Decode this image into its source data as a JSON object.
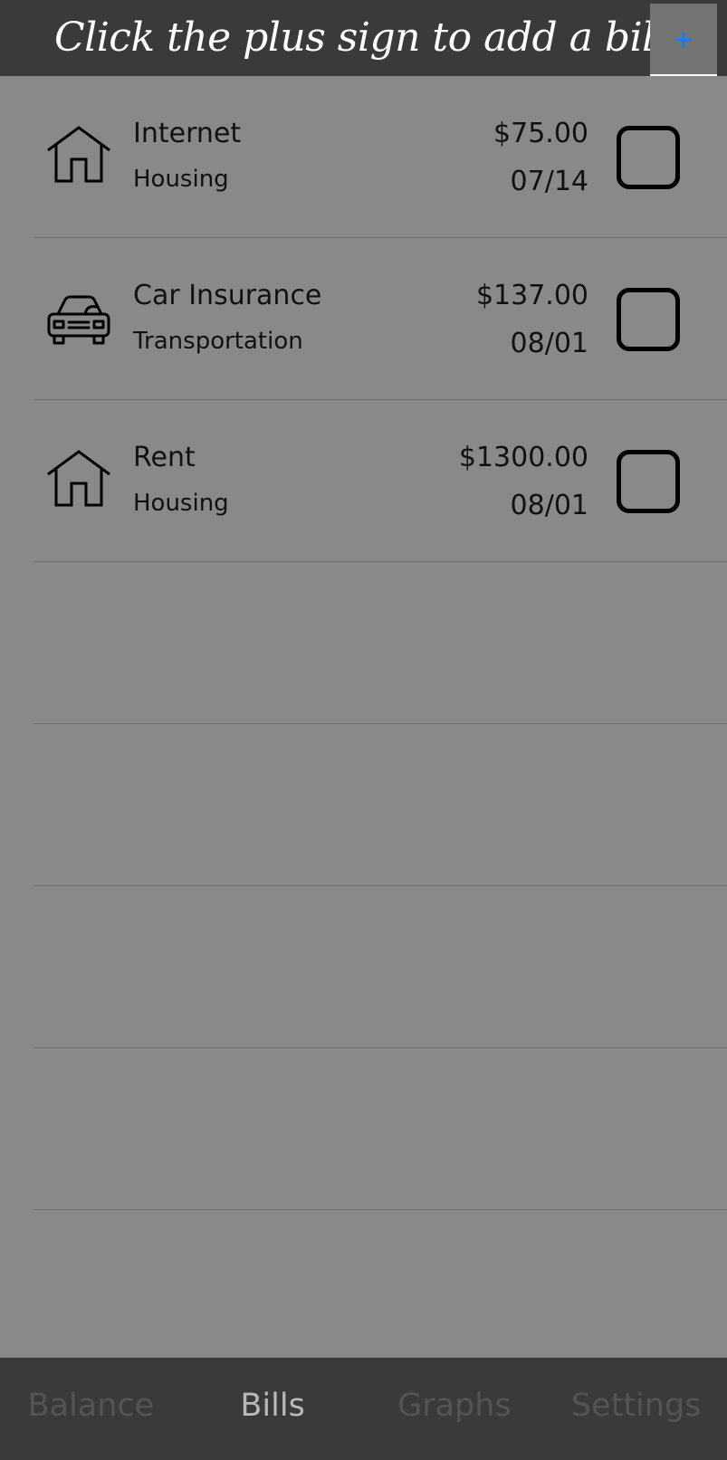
{
  "header": {
    "hint": "Click the plus sign to add a bill",
    "add_label": "+"
  },
  "bills": [
    {
      "name": "Internet",
      "category": "Housing",
      "amount": "$75.00",
      "date": "07/14",
      "icon": "house-icon",
      "paid": false
    },
    {
      "name": "Car Insurance",
      "category": "Transportation",
      "amount": "$137.00",
      "date": "08/01",
      "icon": "car-icon",
      "paid": false
    },
    {
      "name": "Rent",
      "category": "Housing",
      "amount": "$1300.00",
      "date": "08/01",
      "icon": "house-icon",
      "paid": false
    }
  ],
  "tabs": [
    {
      "label": "Balance",
      "active": false
    },
    {
      "label": "Bills",
      "active": true
    },
    {
      "label": "Graphs",
      "active": false
    },
    {
      "label": "Settings",
      "active": false
    }
  ],
  "colors": {
    "background": "#898989",
    "bar": "#3a3a3a",
    "accent": "#1e7cf0",
    "active_tab": "#b9b9b9",
    "inactive_tab": "#545454"
  }
}
